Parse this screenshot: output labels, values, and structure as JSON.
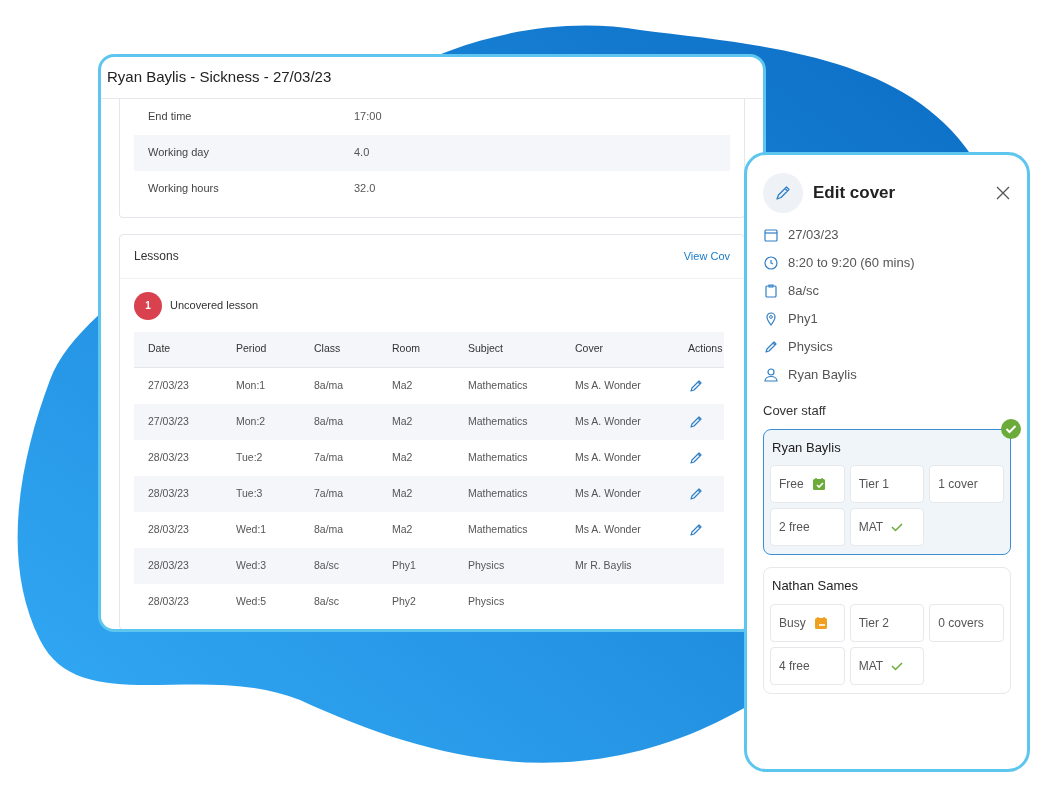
{
  "window": {
    "title": "Ryan Baylis - Sickness - 27/03/23"
  },
  "details": [
    {
      "label": "End time",
      "value": "17:00"
    },
    {
      "label": "Working day",
      "value": "4.0"
    },
    {
      "label": "Working hours",
      "value": "32.0"
    }
  ],
  "lessons": {
    "title": "Lessons",
    "link": "View Cov",
    "uncovered": {
      "count": "1",
      "label": "Uncovered lesson"
    },
    "columns": [
      "Date",
      "Period",
      "Class",
      "Room",
      "Subject",
      "Cover",
      "Actions"
    ],
    "rows": [
      {
        "cells": [
          "27/03/23",
          "Mon:1",
          "8a/ma",
          "Ma2",
          "Mathematics",
          "Ms A. Wonder"
        ],
        "editable": true
      },
      {
        "cells": [
          "27/03/23",
          "Mon:2",
          "8a/ma",
          "Ma2",
          "Mathematics",
          "Ms A. Wonder"
        ],
        "editable": true
      },
      {
        "cells": [
          "28/03/23",
          "Tue:2",
          "7a/ma",
          "Ma2",
          "Mathematics",
          "Ms A. Wonder"
        ],
        "editable": true
      },
      {
        "cells": [
          "28/03/23",
          "Tue:3",
          "7a/ma",
          "Ma2",
          "Mathematics",
          "Ms A. Wonder"
        ],
        "editable": true
      },
      {
        "cells": [
          "28/03/23",
          "Wed:1",
          "8a/ma",
          "Ma2",
          "Mathematics",
          "Ms A. Wonder"
        ],
        "editable": true
      },
      {
        "cells": [
          "28/03/23",
          "Wed:3",
          "8a/sc",
          "Phy1",
          "Physics",
          "Mr R. Baylis"
        ],
        "editable": false
      },
      {
        "cells": [
          "28/03/23",
          "Wed:5",
          "8a/sc",
          "Phy2",
          "Physics",
          ""
        ],
        "editable": false
      }
    ]
  },
  "edit_cover": {
    "title": "Edit cover",
    "details": [
      {
        "kind": "date",
        "text": "27/03/23"
      },
      {
        "kind": "time",
        "text": "8:20 to 9:20 (60 mins)"
      },
      {
        "kind": "class",
        "text": "8a/sc"
      },
      {
        "kind": "room",
        "text": "Phy1"
      },
      {
        "kind": "subject",
        "text": "Physics"
      },
      {
        "kind": "teacher",
        "text": "Ryan Baylis"
      }
    ],
    "staff_title": "Cover staff",
    "staff": [
      {
        "name": "Ryan Baylis",
        "selected": true,
        "availability": {
          "text": "Free",
          "available": true
        },
        "tier": "Tier 1",
        "covers": "1 cover",
        "free": "2 free",
        "mat": {
          "text": "MAT",
          "ok": true
        }
      },
      {
        "name": "Nathan Sames",
        "selected": false,
        "availability": {
          "text": "Busy",
          "available": false
        },
        "tier": "Tier 2",
        "covers": "0 covers",
        "free": "4 free",
        "mat": {
          "text": "MAT",
          "ok": true
        }
      }
    ]
  }
}
